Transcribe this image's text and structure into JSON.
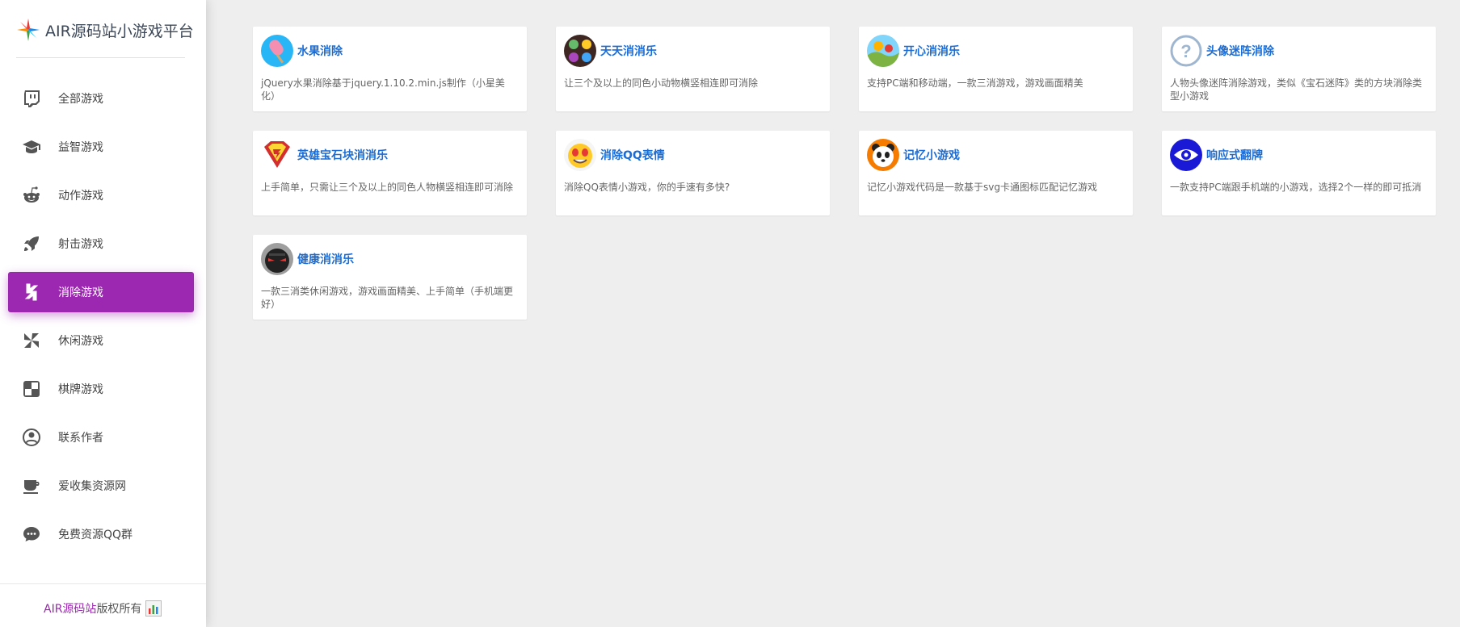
{
  "brand": {
    "title": "AIR源码站小游戏平台",
    "logo_icon": "star-logo-icon"
  },
  "colors": {
    "accent": "#9c27b0",
    "title_link": "#1a6cd6",
    "page_bg": "#eeeeee"
  },
  "sidebar": {
    "items": [
      {
        "label": "全部游戏",
        "icon": "twitch-icon",
        "active": false
      },
      {
        "label": "益智游戏",
        "icon": "graduation-cap-icon",
        "active": false
      },
      {
        "label": "动作游戏",
        "icon": "reddit-robot-icon",
        "active": false
      },
      {
        "label": "射击游戏",
        "icon": "rocket-icon",
        "active": false
      },
      {
        "label": "消除游戏",
        "icon": "hubspot-icon",
        "active": true
      },
      {
        "label": "休闲游戏",
        "icon": "pinwheel-icon",
        "active": false
      },
      {
        "label": "棋牌游戏",
        "icon": "checkerboard-icon",
        "active": false
      },
      {
        "label": "联系作者",
        "icon": "user-circle-icon",
        "active": false
      },
      {
        "label": "爱收集资源网",
        "icon": "coffee-cup-icon",
        "active": false
      },
      {
        "label": "免费资源QQ群",
        "icon": "chat-bubble-icon",
        "active": false
      }
    ]
  },
  "footer": {
    "link": "AIR源码站",
    "text": "版权所有",
    "icon": "stats-chart-icon"
  },
  "games": [
    {
      "title": "水果消除",
      "desc": "jQuery水果消除基于jquery.1.10.2.min.js制作（小星美化）",
      "icon": "popsicle-icon"
    },
    {
      "title": "天天消消乐",
      "desc": "让三个及以上的同色小动物横竖相连即可消除",
      "icon": "animal-tiles-icon"
    },
    {
      "title": "开心消消乐",
      "desc": "支持PC端和移动端，一款三消游戏，游戏画面精美",
      "icon": "candy-landscape-icon"
    },
    {
      "title": "头像迷阵消除",
      "desc": "人物头像迷阵消除游戏，类似《宝石迷阵》类的方块消除类型小游戏",
      "icon": "question-circle-icon"
    },
    {
      "title": "英雄宝石块消消乐",
      "desc": "上手简单，只需让三个及以上的同色人物横竖相连即可消除",
      "icon": "superman-shield-icon"
    },
    {
      "title": "消除QQ表情",
      "desc": "消除QQ表情小游戏，你的手速有多快?",
      "icon": "emoji-face-icon"
    },
    {
      "title": "记忆小游戏",
      "desc": "记忆小游戏代码是一款基于svg卡通图标匹配记忆游戏",
      "icon": "panda-icon"
    },
    {
      "title": "响应式翻牌",
      "desc": "一款支持PC端跟手机端的小游戏，选择2个一样的即可抵消",
      "icon": "eye-icon"
    },
    {
      "title": "健康消消乐",
      "desc": "一款三消类休闲游戏，游戏画面精美、上手简单（手机端更好）",
      "icon": "ninja-icon"
    }
  ]
}
